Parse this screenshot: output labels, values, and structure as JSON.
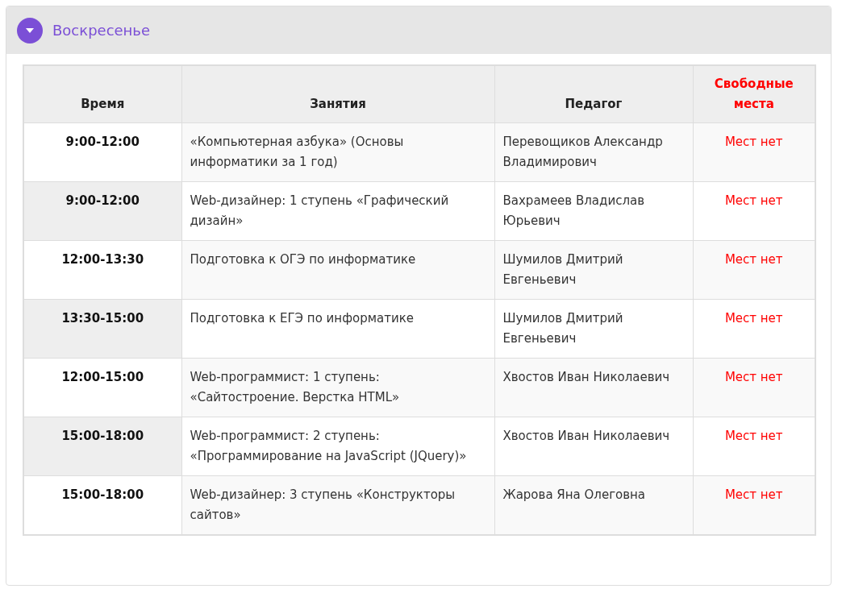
{
  "section": {
    "title": "Воскресенье",
    "expanded": true
  },
  "table": {
    "columns": [
      {
        "label": "Время",
        "kind": "normal"
      },
      {
        "label": "Занятия",
        "kind": "normal"
      },
      {
        "label": "Педагог",
        "kind": "normal"
      },
      {
        "label": "Свободные места",
        "kind": "accent"
      }
    ],
    "rows": [
      {
        "time": "9:00-12:00",
        "course": "«Компьютерная азбука» (Основы информатики за 1 год)",
        "teacher": "Перевощиков Александр Владимирович",
        "seats": "Мест нет"
      },
      {
        "time": "9:00-12:00",
        "course": "Web-дизайнер: 1 ступень «Графический дизайн»",
        "teacher": "Вахрамеев Владислав Юрьевич",
        "seats": "Мест нет"
      },
      {
        "time": "12:00-13:30",
        "course": "Подготовка к ОГЭ по информатике",
        "teacher": "Шумилов Дмитрий Евгеньевич",
        "seats": "Мест нет"
      },
      {
        "time": "13:30-15:00",
        "course": "Подготовка к ЕГЭ по информатике",
        "teacher": "Шумилов Дмитрий Евгеньевич",
        "seats": "Мест нет"
      },
      {
        "time": "12:00-15:00",
        "course": "Web-программист: 1 ступень: «Сайтостроение. Верстка HTML»",
        "teacher": "Хвостов Иван Николаевич",
        "seats": "Мест нет"
      },
      {
        "time": "15:00-18:00",
        "course": "Web-программист: 2 ступень: «Программирование на JavaScript (JQuery)»",
        "teacher": "Хвостов Иван Николаевич",
        "seats": "Мест нет"
      },
      {
        "time": "15:00-18:00",
        "course": "Web-дизайнер: 3 ступень «Конструкторы сайтов»",
        "teacher": "Жарова Яна Олеговна",
        "seats": "Мест нет"
      }
    ]
  }
}
